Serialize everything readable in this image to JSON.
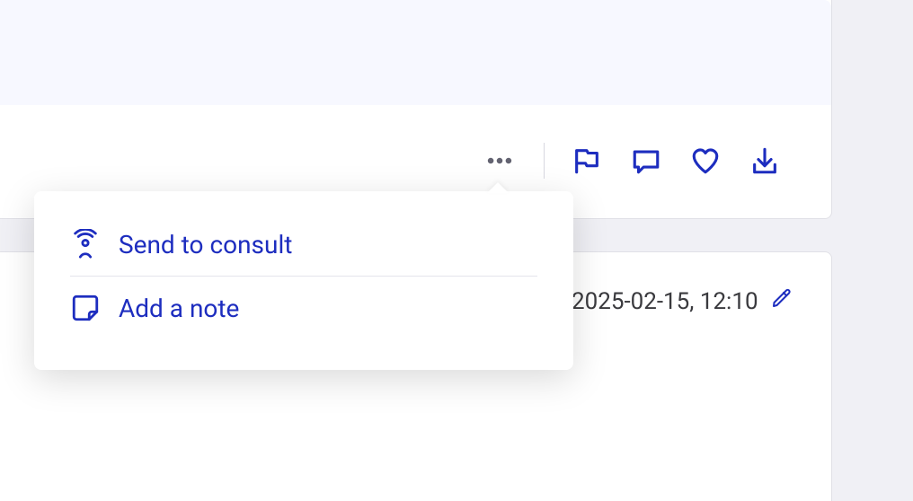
{
  "colors": {
    "accent": "#1d2dbf"
  },
  "popover": {
    "items": [
      {
        "icon": "broadcast-icon",
        "label": "Send to consult"
      },
      {
        "icon": "sticky-note-icon",
        "label": "Add a note"
      }
    ]
  },
  "timestamp": "2025-02-15, 12:10"
}
